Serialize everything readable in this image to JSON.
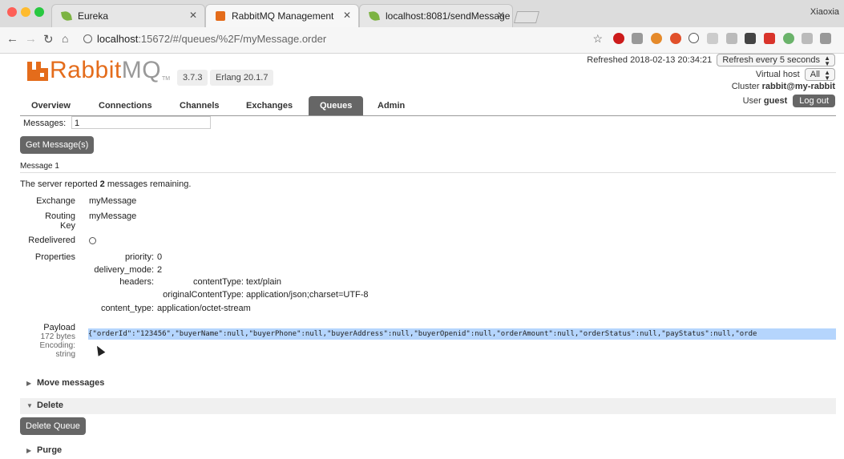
{
  "browser": {
    "tabs": [
      {
        "title": "Eureka",
        "icon": "spring-leaf-icon"
      },
      {
        "title": "RabbitMQ Management",
        "icon": "rabbitmq-icon"
      },
      {
        "title": "localhost:8081/sendMessage",
        "icon": "spring-leaf-icon"
      }
    ],
    "profile_name": "Xiaoxia",
    "url_host": "localhost",
    "url_rest": ":15672/#/queues/%2F/myMessage.order"
  },
  "header": {
    "logo_text_a": "Rabbit",
    "logo_text_b": "MQ",
    "logo_tm": "TM",
    "version": "3.7.3",
    "erlang": "Erlang 20.1.7",
    "refreshed_label": "Refreshed",
    "refreshed_time": "2018-02-13 20:34:21",
    "refresh_option": "Refresh every 5 seconds",
    "vhost_label": "Virtual host",
    "vhost_value": "All",
    "cluster_label": "Cluster",
    "cluster_value": "rabbit@my-rabbit",
    "user_label": "User",
    "user_value": "guest",
    "logout_label": "Log out"
  },
  "nav": {
    "tabs": [
      "Overview",
      "Connections",
      "Channels",
      "Exchanges",
      "Queues",
      "Admin"
    ],
    "active": "Queues"
  },
  "get_messages": {
    "messages_label": "Messages:",
    "messages_value": "1",
    "button_label": "Get Message(s)"
  },
  "message": {
    "heading": "Message 1",
    "remaining_pre": "The server reported",
    "remaining_count": "2",
    "remaining_post": "messages remaining.",
    "exchange_label": "Exchange",
    "exchange_value": "myMessage",
    "routing_label_1": "Routing",
    "routing_label_2": "Key",
    "routing_value": "myMessage",
    "redelivered_label": "Redelivered",
    "redelivered_value": "○",
    "properties_label": "Properties",
    "properties": {
      "priority_key": "priority:",
      "priority_val": "0",
      "delivery_key": "delivery_mode:",
      "delivery_val": "2",
      "headers_key": "headers:",
      "ct_key": "contentType:",
      "ct_val": "text/plain",
      "oct_key": "originalContentType:",
      "oct_val": "application/json;charset=UTF-8",
      "content_type_key": "content_type:",
      "content_type_val": "application/octet-stream"
    },
    "payload_label": "Payload",
    "payload_size": "172 bytes",
    "encoding_label": "Encoding:",
    "encoding_value": "string",
    "payload": "{\"orderId\":\"123456\",\"buyerName\":null,\"buyerPhone\":null,\"buyerAddress\":null,\"buyerOpenid\":null,\"orderAmount\":null,\"orderStatus\":null,\"payStatus\":null,\"orde"
  },
  "sections": {
    "move_label": "Move messages",
    "delete_label": "Delete",
    "delete_button": "Delete Queue",
    "purge_label": "Purge"
  }
}
